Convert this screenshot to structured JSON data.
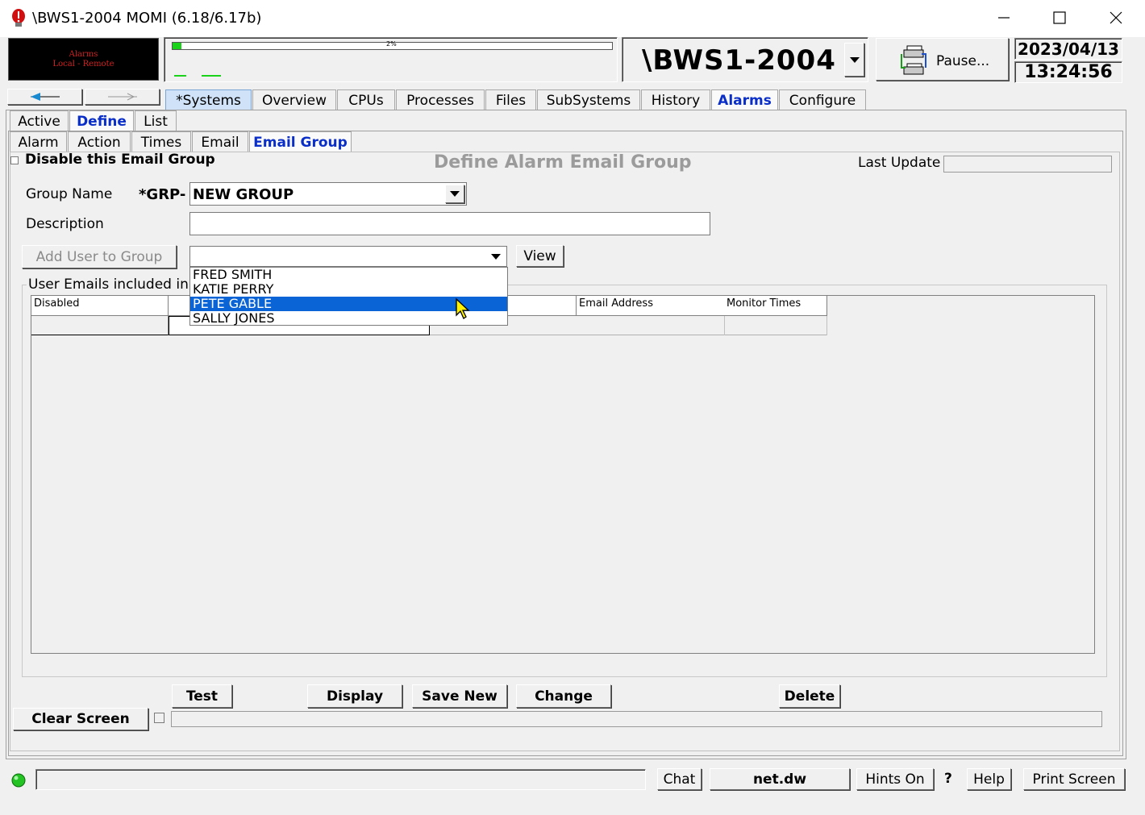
{
  "window": {
    "title": "\\BWS1-2004 MOMI (6.18/6.17b)"
  },
  "header": {
    "alarm_banner": {
      "line1": "Alarms",
      "line2": "Local - Remote"
    },
    "progress": {
      "label": "2%",
      "fraction": 0.02
    },
    "system_name": "\\BWS1-2004",
    "pause_label": "Pause...",
    "date": "2023/04/13",
    "time": "13:24:56"
  },
  "main_tabs": [
    "*Systems",
    "Overview",
    "CPUs",
    "Processes",
    "Files",
    "SubSystems",
    "History",
    "Alarms",
    "Configure"
  ],
  "alarm_tabs": [
    "Active",
    "Define",
    "List"
  ],
  "define_tabs": [
    "Alarm",
    "Action",
    "Times",
    "Email",
    "Email Group"
  ],
  "form": {
    "disable_label": "Disable this Email Group",
    "heading": "Define Alarm Email Group",
    "last_update_label": "Last Update",
    "last_update_value": "",
    "group_name_label": "Group Name",
    "group_prefix": "*GRP-",
    "group_name_value": "NEW GROUP",
    "description_label": "Description",
    "description_value": "",
    "add_user_label": "Add User to Group",
    "user_select_value": "",
    "view_label": "View",
    "users_options": [
      "FRED SMITH",
      "KATIE PERRY",
      "PETE GABLE",
      "SALLY JONES"
    ],
    "selected_user": "PETE GABLE",
    "group_box_label": "User Emails included in t",
    "columns": {
      "disabled": "Disabled",
      "email": "Email Address",
      "monitor": "Monitor Times"
    }
  },
  "actions": {
    "test": "Test",
    "display": "Display",
    "save_new": "Save New",
    "change": "Change",
    "delete": "Delete",
    "clear_screen": "Clear Screen"
  },
  "status_bar": {
    "message": "",
    "chat": "Chat",
    "net": "net.dw",
    "hints": "Hints On",
    "question": "?",
    "help": "Help",
    "print": "Print Screen"
  },
  "colors": {
    "active_tab_text": "#0a2ec8",
    "selection": "#0a64d6",
    "alarm_banner_bg": "#000000",
    "alarm_banner_text": "#d02020",
    "status_led": "#22c322"
  }
}
